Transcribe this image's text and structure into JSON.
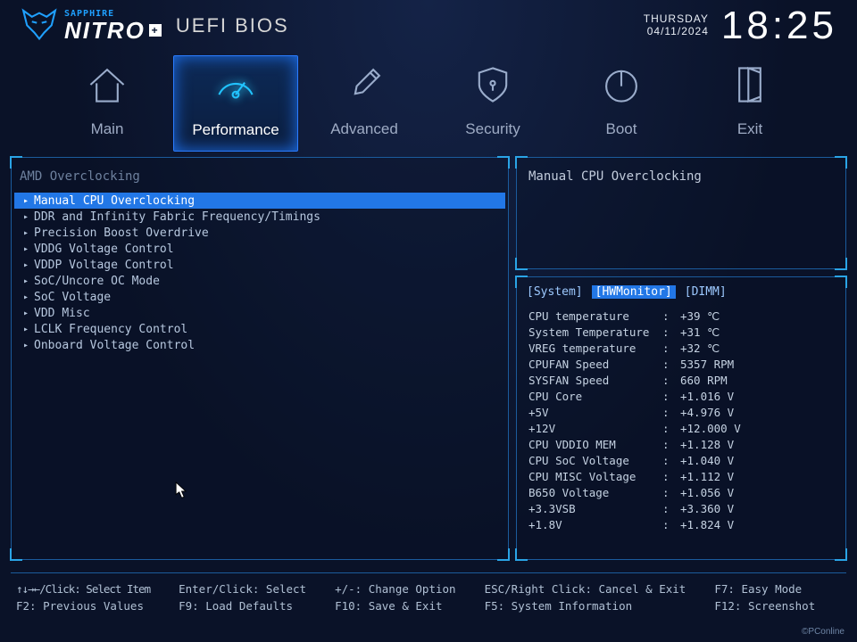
{
  "header": {
    "brand_small": "SAPPHIRE",
    "brand_main": "NITRO",
    "bios_title": "UEFI BIOS",
    "day": "THURSDAY",
    "date": "04/11/2024",
    "time": "18:25"
  },
  "tabs": [
    {
      "label": "Main"
    },
    {
      "label": "Performance"
    },
    {
      "label": "Advanced"
    },
    {
      "label": "Security"
    },
    {
      "label": "Boot"
    },
    {
      "label": "Exit"
    }
  ],
  "active_tab_index": 1,
  "section_title": "AMD Overclocking",
  "menu_items": [
    "Manual CPU Overclocking",
    "DDR and Infinity Fabric Frequency/Timings",
    "Precision Boost Overdrive",
    "VDDG Voltage Control",
    "VDDP Voltage Control",
    "SoC/Uncore OC Mode",
    "SoC Voltage",
    "VDD Misc",
    "LCLK Frequency Control",
    "Onboard Voltage Control"
  ],
  "selected_menu_index": 0,
  "help_title": "Manual CPU Overclocking",
  "monitor_tabs": [
    "System",
    "HWMonitor",
    "DIMM"
  ],
  "monitor_active_index": 1,
  "readings": [
    {
      "label": "CPU temperature",
      "value": "+39 ℃"
    },
    {
      "label": "System Temperature",
      "value": "+31 ℃"
    },
    {
      "label": "VREG temperature",
      "value": "+32 ℃"
    },
    {
      "label": "CPUFAN Speed",
      "value": "5357 RPM"
    },
    {
      "label": "SYSFAN Speed",
      "value": "660 RPM"
    },
    {
      "label": "CPU Core",
      "value": "+1.016 V"
    },
    {
      "label": "+5V",
      "value": "+4.976 V"
    },
    {
      "label": "+12V",
      "value": "+12.000 V"
    },
    {
      "label": "CPU VDDIO MEM",
      "value": "+1.128 V"
    },
    {
      "label": "CPU SoC Voltage",
      "value": "+1.040 V"
    },
    {
      "label": "CPU MISC Voltage",
      "value": "+1.112 V"
    },
    {
      "label": "B650 Voltage",
      "value": "+1.056 V"
    },
    {
      "label": "+3.3VSB",
      "value": "+3.360 V"
    },
    {
      "label": "+1.8V",
      "value": "+1.824 V"
    }
  ],
  "footer": {
    "c1a": "↑↓→←/Click: Select Item",
    "c1b": "F2: Previous Values",
    "c2a": "Enter/Click: Select",
    "c2b": "F9: Load Defaults",
    "c3a": "+/-: Change Option",
    "c3b": "F10: Save & Exit",
    "c4a": "ESC/Right Click: Cancel & Exit",
    "c4b": "F5: System Information",
    "c5a": "F7: Easy Mode",
    "c5b": "F12: Screenshot"
  },
  "watermark": "©PConline"
}
